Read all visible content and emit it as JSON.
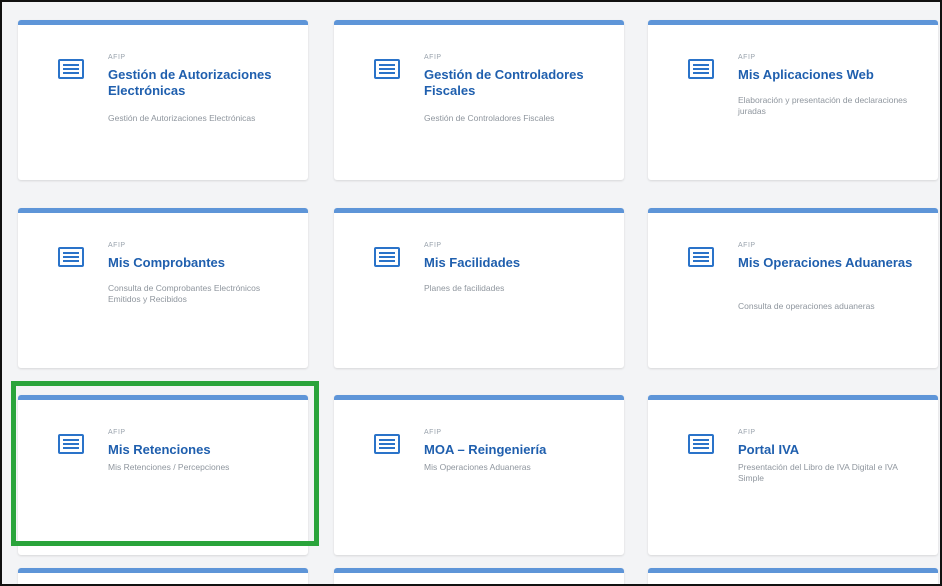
{
  "cards": [
    {
      "org": "AFIP",
      "title": "Gestión de Autorizaciones Electrónicas",
      "desc": "Gestión de Autorizaciones Electrónicas"
    },
    {
      "org": "AFIP",
      "title": "Gestión de Controladores Fiscales",
      "desc": "Gestión de Controladores Fiscales"
    },
    {
      "org": "AFIP",
      "title": "Mis Aplicaciones Web",
      "desc": "Elaboración y presentación de declaraciones juradas"
    },
    {
      "org": "AFIP",
      "title": "Mis Comprobantes",
      "desc": "Consulta de Comprobantes Electrónicos Emitidos y Recibidos"
    },
    {
      "org": "AFIP",
      "title": "Mis Facilidades",
      "desc": "Planes de facilidades"
    },
    {
      "org": "AFIP",
      "title": "Mis Operaciones Aduaneras",
      "desc": "Consulta de operaciones aduaneras"
    },
    {
      "org": "AFIP",
      "title": "Mis Retenciones",
      "desc": "Mis Retenciones / Percepciones"
    },
    {
      "org": "AFIP",
      "title": "MOA – Reingeniería",
      "desc": "Mis Operaciones Aduaneras"
    },
    {
      "org": "AFIP",
      "title": "Portal IVA",
      "desc": "Presentación del Libro de IVA Digital e IVA Simple"
    }
  ],
  "colors": {
    "accent_bar": "#5e95d8",
    "title": "#1f5fae",
    "selection": "#2aa43b"
  }
}
